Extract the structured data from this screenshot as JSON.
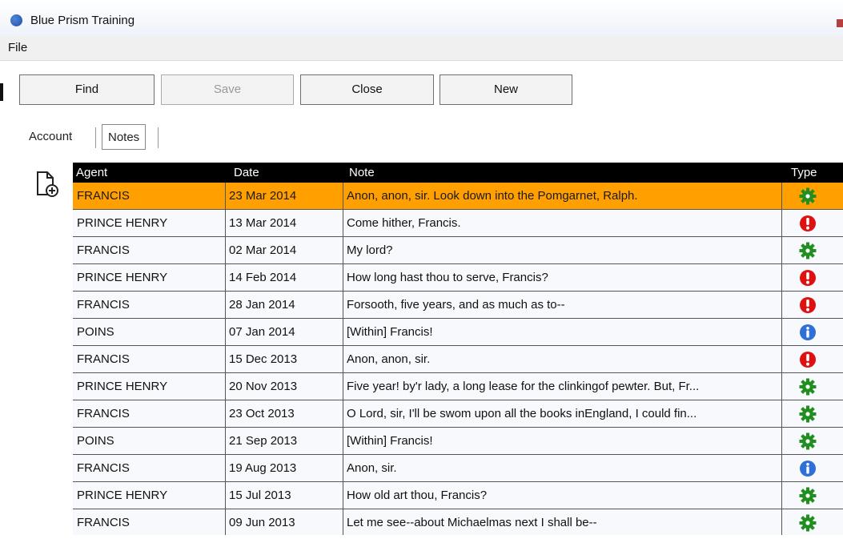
{
  "window": {
    "title": "Blue Prism Training"
  },
  "menu": {
    "file": "File"
  },
  "toolbar": {
    "find": "Find",
    "save": "Save",
    "close": "Close",
    "new": "New"
  },
  "tabs": [
    {
      "label": "Account",
      "selected": false
    },
    {
      "label": "Notes",
      "selected": true
    }
  ],
  "add_note_icon": "add-note-icon",
  "grid": {
    "columns": [
      "Agent",
      "Date",
      "Note",
      "Type"
    ],
    "selected_row_color": "#ff9f00",
    "rows": [
      {
        "agent": "FRANCIS",
        "date": "23 Mar 2014",
        "note": "Anon, anon, sir. Look down into the Pomgarnet, Ralph.",
        "type": "gear"
      },
      {
        "agent": "PRINCE HENRY",
        "date": "13 Mar 2014",
        "note": "Come hither, Francis.",
        "type": "alert"
      },
      {
        "agent": "FRANCIS",
        "date": "02 Mar 2014",
        "note": "My lord?",
        "type": "gear"
      },
      {
        "agent": "PRINCE HENRY",
        "date": "14 Feb 2014",
        "note": "How long hast thou to serve, Francis?",
        "type": "alert"
      },
      {
        "agent": "FRANCIS",
        "date": "28 Jan 2014",
        "note": "Forsooth, five years, and as much as to--",
        "type": "alert"
      },
      {
        "agent": "POINS",
        "date": "07 Jan 2014",
        "note": "[Within]  Francis!",
        "type": "info"
      },
      {
        "agent": "FRANCIS",
        "date": "15 Dec 2013",
        "note": "Anon, anon, sir.",
        "type": "alert"
      },
      {
        "agent": "PRINCE HENRY",
        "date": "20 Nov 2013",
        "note": "Five year! by'r lady, a long lease for the clinkingof pewter. But, Fr...",
        "type": "gear"
      },
      {
        "agent": "FRANCIS",
        "date": "23 Oct 2013",
        "note": "O Lord, sir, I'll be swom upon all the books inEngland, I could fin...",
        "type": "gear"
      },
      {
        "agent": "POINS",
        "date": "21 Sep 2013",
        "note": "[Within]  Francis!",
        "type": "gear"
      },
      {
        "agent": "FRANCIS",
        "date": "19 Aug 2013",
        "note": "Anon, sir.",
        "type": "info"
      },
      {
        "agent": "PRINCE HENRY",
        "date": "15 Jul 2013",
        "note": "How old art thou, Francis?",
        "type": "gear"
      },
      {
        "agent": "FRANCIS",
        "date": "09 Jun 2013",
        "note": "Let me see--about Michaelmas next I shall be--",
        "type": "gear"
      }
    ]
  },
  "colors": {
    "gear": "#1f8f1f",
    "alert": "#e01010",
    "info": "#2f6fd8"
  }
}
